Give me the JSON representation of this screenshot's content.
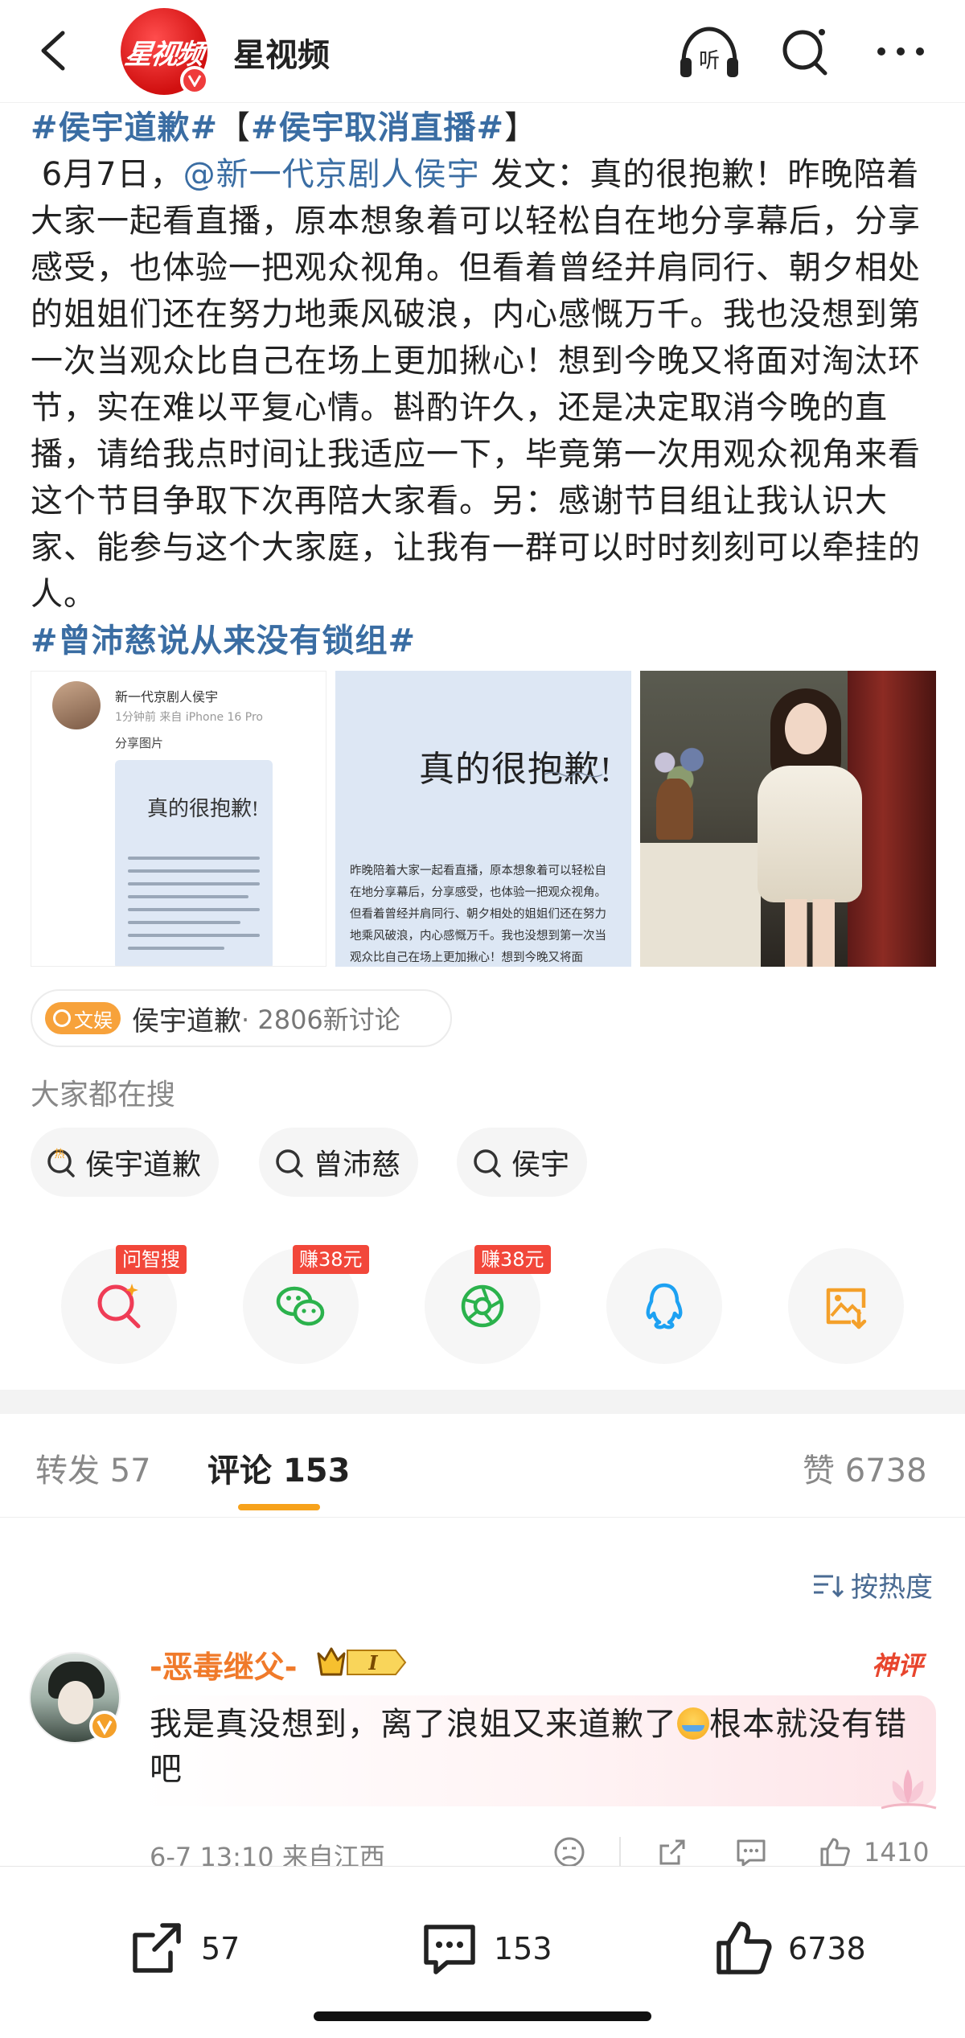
{
  "header": {
    "logo_text": "星视频",
    "title": "星视频",
    "listen_label": "听",
    "icons": {
      "back": "back-arrow-icon",
      "listen": "headphones-icon",
      "search": "search-icon",
      "more": "more-icon"
    }
  },
  "post": {
    "tag1": "#侯宇道歉#",
    "bracket_open": "【",
    "tag2": "#侯宇取消直播#",
    "bracket_close": "】",
    "date_prefix": "6月7日，",
    "mention": "@新一代京剧人侯宇",
    "body": " 发文：真的很抱歉！昨晚陪着大家一起看直播，原本想象着可以轻松自在地分享幕后，分享感受，也体验一把观众视角。但看着曾经并肩同行、朝夕相处的姐姐们还在努力地乘风破浪，内心感慨万千。我也没想到第一次当观众比自己在场上更加揪心！想到今晚又将面对淘汰环节，实在难以平复心情。斟酌许久，还是决定取消今晚的直播，请给我点时间让我适应一下，毕竟第一次用观众视角来看这个节目争取下次再陪大家看。另：感谢节目组让我认识大家、能参与这个大家庭，让我有一群可以时时刻刻可以牵挂的人。",
    "tag3": "#曾沛慈说从来没有锁组#"
  },
  "images": {
    "thumb1": {
      "name": "新一代京剧人侯宇",
      "meta": "1分钟前 来自 iPhone 16 Pro",
      "share": "分享图片",
      "card_title": "真的很抱歉!"
    },
    "thumb2": {
      "title": "真的很抱歉!",
      "body": "昨晚陪着大家一起看直播，原本想象着可以轻松自在地分享幕后，分享感受，也体验一把观众视角。但看着曾经并肩同行、朝夕相处的姐姐们还在努力地乘风破浪，内心感慨万千。我也没想到第一次当观众比自己在场上更加揪心！想到今晚又将面"
    }
  },
  "topic": {
    "badge": "文娱",
    "text": "侯宇道歉",
    "count": " · 2806新讨论"
  },
  "search": {
    "title": "大家都在搜",
    "chips": [
      {
        "label": "侯宇道歉",
        "icon": "hot-search-icon"
      },
      {
        "label": "曾沛慈",
        "icon": "search-icon"
      },
      {
        "label": "侯宇",
        "icon": "search-icon"
      }
    ]
  },
  "share": {
    "items": [
      {
        "icon": "ai-search-icon",
        "badge": "问智搜"
      },
      {
        "icon": "wechat-icon",
        "badge": "赚38元"
      },
      {
        "icon": "moments-icon",
        "badge": "赚38元"
      },
      {
        "icon": "qq-icon",
        "badge": ""
      },
      {
        "icon": "save-image-icon",
        "badge": ""
      }
    ]
  },
  "tabs": {
    "repost_label": "转发",
    "repost_count": "57",
    "comment_label": "评论",
    "comment_count": "153",
    "like_label": "赞",
    "like_count": "6738"
  },
  "sort": {
    "label": "按热度",
    "icon": "sort-icon"
  },
  "comment": {
    "username": "-恶毒继父-",
    "level": "I",
    "badge": "神评",
    "text_before": "我是真没想到，离了浪姐又来道歉了",
    "text_after": "根本就没有错吧",
    "emoji": "laugh-cry-emoji",
    "meta": "6-7 13:10 来自江西",
    "likes": "1410"
  },
  "bottom_bar": {
    "share_count": "57",
    "comment_count": "153",
    "like_count": "6738"
  },
  "colors": {
    "link": "#3a6da3",
    "accent": "#f7a21b",
    "username": "#f07a2a",
    "badge_red": "#f2473a"
  }
}
